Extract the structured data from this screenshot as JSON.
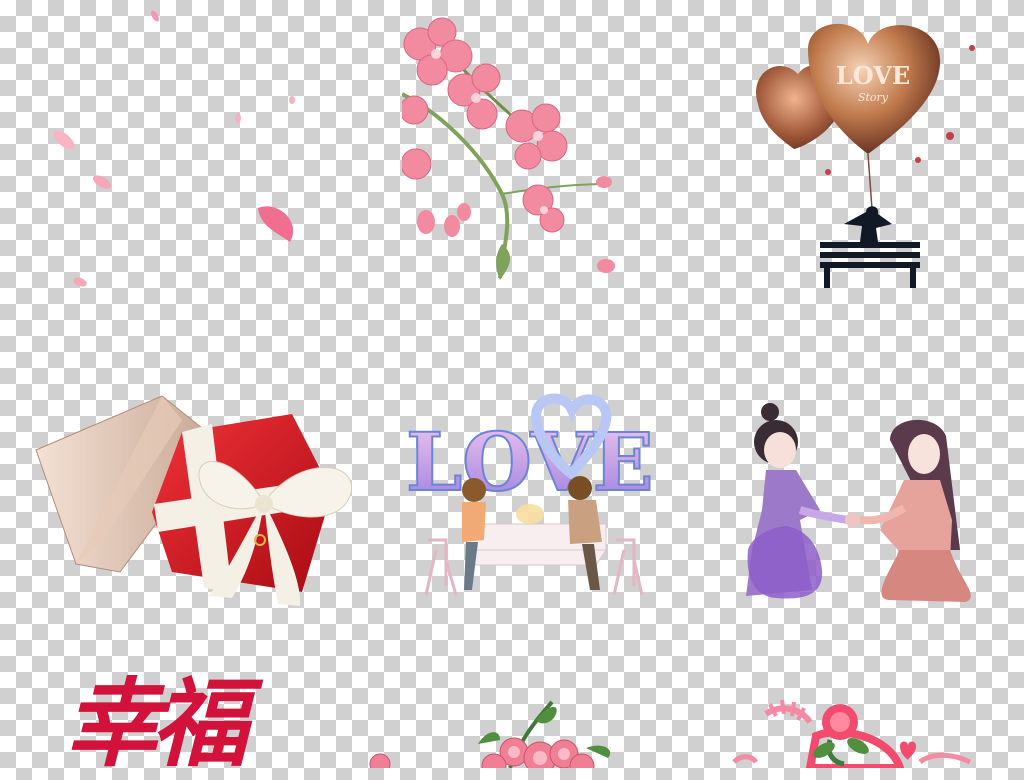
{
  "canvas": {
    "background": "transparency-checkerboard",
    "checker_colors": [
      "#ffffff",
      "#d0d0d0"
    ]
  },
  "stickers": {
    "falling_petals": {
      "icon": "petals-icon",
      "color": "#f4a7b9"
    },
    "cherry_blossom_branch": {
      "icon": "blossom-branch-icon",
      "color": "#f28aa0"
    },
    "love_story_balloon": {
      "title": "LOVE",
      "subtitle": "Story",
      "color": "#b86a3c"
    },
    "gift_box": {
      "icon": "gift-box-icon",
      "color": "#d3121a"
    },
    "love_couple_dinner": {
      "title": "LOVE",
      "color": "#e6a0d8"
    },
    "couple_holding_hands": {
      "icon": "couple-icon",
      "color": "#9c79c9"
    },
    "calligraphy": {
      "text": "幸福",
      "color": "#d2123b"
    },
    "pink_roses": {
      "icon": "rose-bouquet-icon",
      "color": "#f07f95"
    },
    "rose_heart_decoration": {
      "icon": "rose-heart-icon",
      "color": "#f24b6e"
    }
  }
}
